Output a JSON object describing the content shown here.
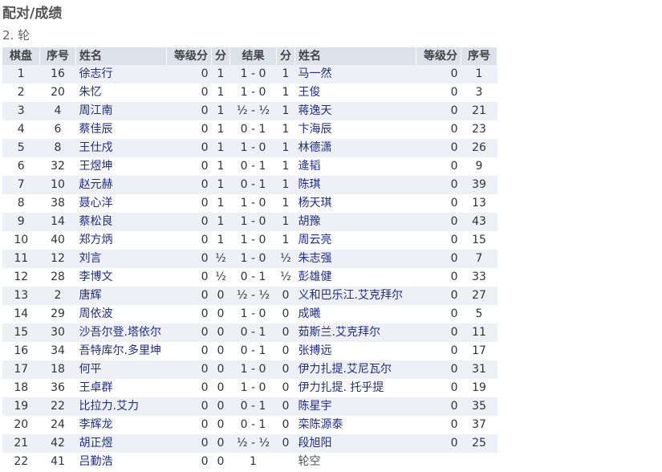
{
  "page_title": "配对/成绩",
  "round_label": "2. 轮",
  "columns": {
    "board": "棋盘",
    "seq": "序号",
    "name": "姓名",
    "rating": "等级分",
    "points": "分",
    "result": "结果",
    "points2": "分",
    "name2": "姓名",
    "rating2": "等级分",
    "seq2": "序号"
  },
  "rows": [
    {
      "board": "1",
      "seq": "16",
      "name": "徐志行",
      "rating": "0",
      "pts": "1",
      "result": "1 - 0",
      "pts2": "1",
      "name2": "马一然",
      "rating2": "0",
      "seq2": "1"
    },
    {
      "board": "2",
      "seq": "20",
      "name": "朱忆",
      "rating": "0",
      "pts": "1",
      "result": "1 - 0",
      "pts2": "1",
      "name2": "王俊",
      "rating2": "0",
      "seq2": "3"
    },
    {
      "board": "3",
      "seq": "4",
      "name": "周江南",
      "rating": "0",
      "pts": "1",
      "result": "½ - ½",
      "pts2": "1",
      "name2": "蒋逸天",
      "rating2": "0",
      "seq2": "21"
    },
    {
      "board": "4",
      "seq": "6",
      "name": "蔡佳辰",
      "rating": "0",
      "pts": "1",
      "result": "0 - 1",
      "pts2": "1",
      "name2": "卞海辰",
      "rating2": "0",
      "seq2": "23"
    },
    {
      "board": "5",
      "seq": "8",
      "name": "王仕戍",
      "rating": "0",
      "pts": "1",
      "result": "1 - 0",
      "pts2": "1",
      "name2": "林德潇",
      "rating2": "0",
      "seq2": "26"
    },
    {
      "board": "6",
      "seq": "32",
      "name": "王煜坤",
      "rating": "0",
      "pts": "1",
      "result": "0 - 1",
      "pts2": "1",
      "name2": "逄韬",
      "rating2": "0",
      "seq2": "9"
    },
    {
      "board": "7",
      "seq": "10",
      "name": "赵元赫",
      "rating": "0",
      "pts": "1",
      "result": "0 - 1",
      "pts2": "1",
      "name2": "陈琪",
      "rating2": "0",
      "seq2": "39"
    },
    {
      "board": "8",
      "seq": "38",
      "name": "聂心洋",
      "rating": "0",
      "pts": "1",
      "result": "1 - 0",
      "pts2": "1",
      "name2": "杨天琪",
      "rating2": "0",
      "seq2": "13"
    },
    {
      "board": "9",
      "seq": "14",
      "name": "蔡松良",
      "rating": "0",
      "pts": "1",
      "result": "1 - 0",
      "pts2": "1",
      "name2": "胡豫",
      "rating2": "0",
      "seq2": "43"
    },
    {
      "board": "10",
      "seq": "40",
      "name": "郑方炳",
      "rating": "0",
      "pts": "1",
      "result": "1 - 0",
      "pts2": "1",
      "name2": "周云亮",
      "rating2": "0",
      "seq2": "15"
    },
    {
      "board": "11",
      "seq": "12",
      "name": "刘言",
      "rating": "0",
      "pts": "½",
      "result": "1 - 0",
      "pts2": "½",
      "name2": "朱志强",
      "rating2": "0",
      "seq2": "7"
    },
    {
      "board": "12",
      "seq": "28",
      "name": "李博文",
      "rating": "0",
      "pts": "½",
      "result": "0 - 1",
      "pts2": "½",
      "name2": "彭雄健",
      "rating2": "0",
      "seq2": "33"
    },
    {
      "board": "13",
      "seq": "2",
      "name": "唐辉",
      "rating": "0",
      "pts": "0",
      "result": "½ - ½",
      "pts2": "0",
      "name2": "义和巴乐江.艾克拜尔",
      "rating2": "0",
      "seq2": "27"
    },
    {
      "board": "14",
      "seq": "29",
      "name": "周依波",
      "rating": "0",
      "pts": "0",
      "result": "1 - 0",
      "pts2": "0",
      "name2": "成曦",
      "rating2": "0",
      "seq2": "5"
    },
    {
      "board": "15",
      "seq": "30",
      "name": "沙吾尔登.塔依尔",
      "rating": "0",
      "pts": "0",
      "result": "0 - 1",
      "pts2": "0",
      "name2": "茹斯兰.艾克拜尔",
      "rating2": "0",
      "seq2": "11"
    },
    {
      "board": "16",
      "seq": "34",
      "name": "吾特库尔.多里坤",
      "rating": "0",
      "pts": "0",
      "result": "0 - 1",
      "pts2": "0",
      "name2": "张搏远",
      "rating2": "0",
      "seq2": "17"
    },
    {
      "board": "17",
      "seq": "18",
      "name": "何平",
      "rating": "0",
      "pts": "0",
      "result": "1 - 0",
      "pts2": "0",
      "name2": "伊力扎提.艾尼瓦尔",
      "rating2": "0",
      "seq2": "31"
    },
    {
      "board": "18",
      "seq": "36",
      "name": "王卓群",
      "rating": "0",
      "pts": "0",
      "result": "1 - 0",
      "pts2": "0",
      "name2": "伊力扎提. 托乎提",
      "rating2": "0",
      "seq2": "19"
    },
    {
      "board": "19",
      "seq": "22",
      "name": "比拉力.艾力",
      "rating": "0",
      "pts": "0",
      "result": "0 - 1",
      "pts2": "0",
      "name2": "陈星宇",
      "rating2": "0",
      "seq2": "35"
    },
    {
      "board": "20",
      "seq": "24",
      "name": "李辉龙",
      "rating": "0",
      "pts": "0",
      "result": "0 - 1",
      "pts2": "0",
      "name2": "栾陈源泰",
      "rating2": "0",
      "seq2": "37"
    },
    {
      "board": "21",
      "seq": "42",
      "name": "胡正煜",
      "rating": "0",
      "pts": "0",
      "result": "½ - ½",
      "pts2": "0",
      "name2": "段旭阳",
      "rating2": "0",
      "seq2": "25"
    },
    {
      "board": "22",
      "seq": "41",
      "name": "吕勤浩",
      "rating": "0",
      "pts": "0",
      "result": "1",
      "pts2": "",
      "name2": "轮空",
      "rating2": "",
      "seq2": "",
      "bye": true
    }
  ]
}
